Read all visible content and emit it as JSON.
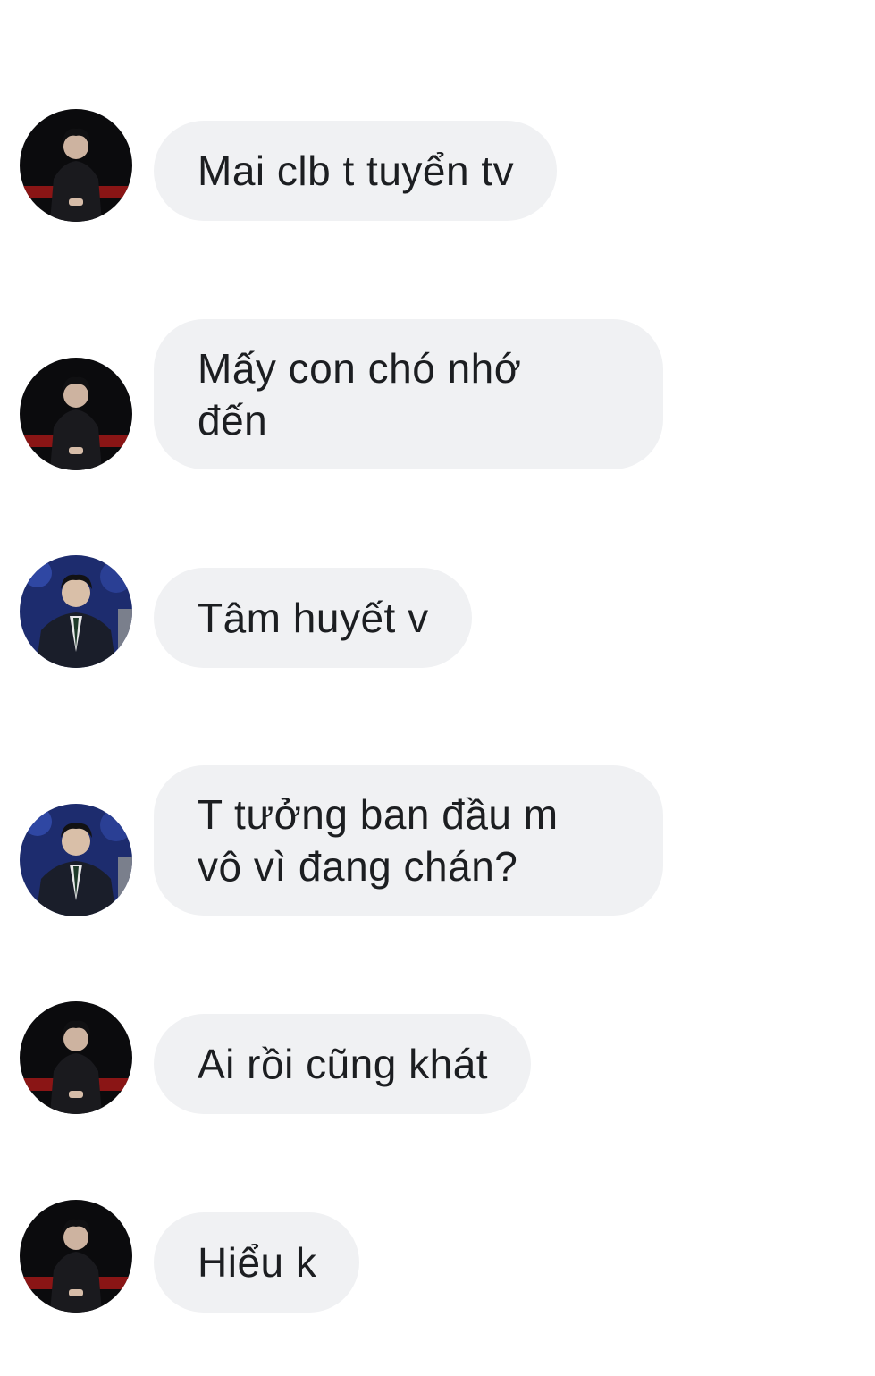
{
  "messages": [
    {
      "text": "Mai clb t tuyển tv",
      "avatar": "avatar-dark"
    },
    {
      "text": "Mấy con chó nhớ\nđến",
      "avatar": "avatar-dark"
    },
    {
      "text": "Tâm huyết v",
      "avatar": "avatar-suit"
    },
    {
      "text": "T tưởng ban đầu m\nvô vì đang chán?",
      "avatar": "avatar-suit"
    },
    {
      "text": "Ai rồi cũng khát",
      "avatar": "avatar-dark"
    },
    {
      "text": "Hiểu k",
      "avatar": "avatar-dark"
    }
  ],
  "colors": {
    "bubble_bg": "#f0f1f3",
    "text": "#1c1e21"
  }
}
